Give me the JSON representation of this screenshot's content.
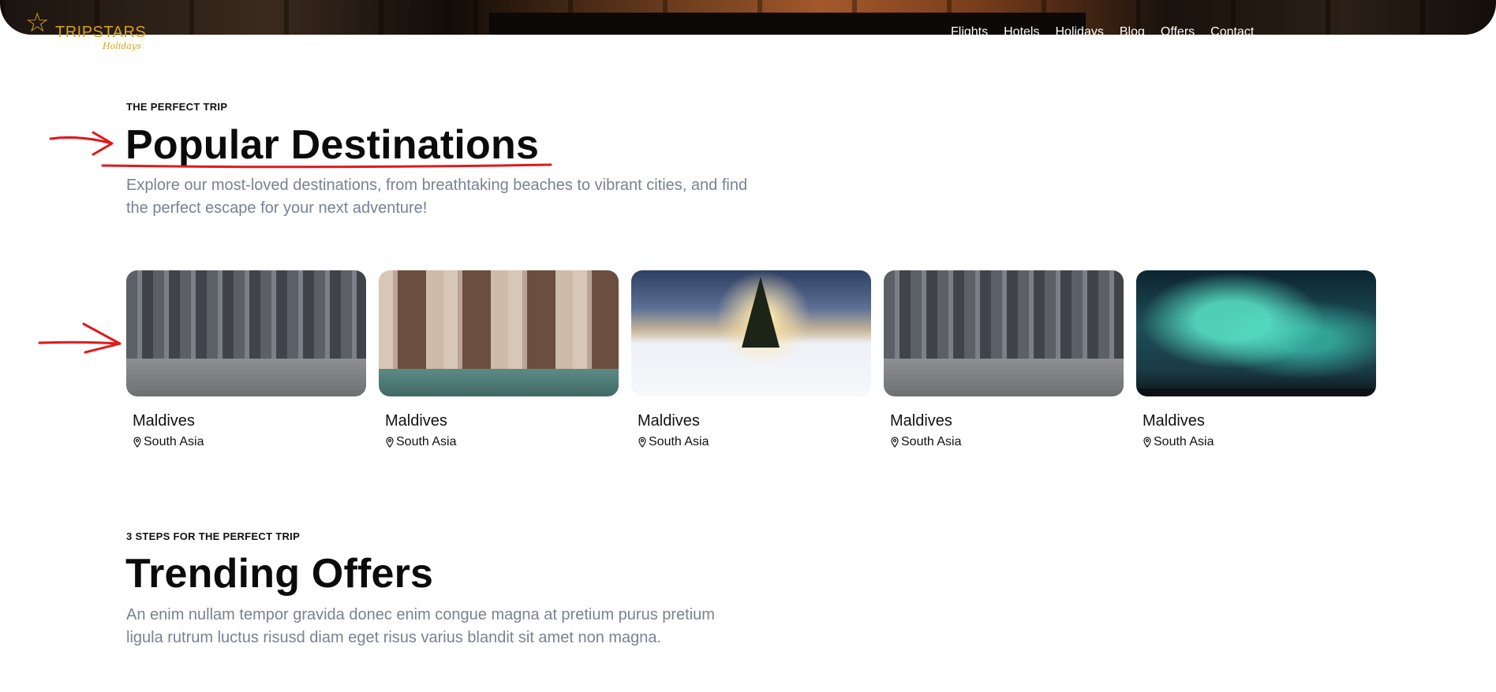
{
  "header": {
    "logo_brand": "TRIPSTARS",
    "logo_tagline": "Holidays",
    "nav": [
      "Flights",
      "Hotels",
      "Holidays",
      "Blog",
      "Offers",
      "Contact"
    ]
  },
  "destinations": {
    "eyebrow": "THE PERFECT TRIP",
    "title": "Popular Destinations",
    "lead": "Explore our most-loved destinations, from breathtaking beaches to vibrant cities, and find the perfect escape for your next adventure!",
    "cards": [
      {
        "name": "Maldives",
        "location": "South Asia",
        "image": "city-street"
      },
      {
        "name": "Maldives",
        "location": "South Asia",
        "image": "building-columns"
      },
      {
        "name": "Maldives",
        "location": "South Asia",
        "image": "snowy-sunset"
      },
      {
        "name": "Maldives",
        "location": "South Asia",
        "image": "city-street"
      },
      {
        "name": "Maldives",
        "location": "South Asia",
        "image": "aurora"
      }
    ]
  },
  "offers": {
    "eyebrow": "3 STEPS FOR THE PERFECT TRIP",
    "title": "Trending Offers",
    "lead": "An enim nullam tempor gravida donec enim congue magna at pretium purus pretium ligula rutrum luctus risusd diam eget risus varius blandit sit amet non magna."
  },
  "colors": {
    "brand_gold": "#d4a21c",
    "annotation_red": "#e0191b",
    "lead_gray": "#7a8191"
  }
}
